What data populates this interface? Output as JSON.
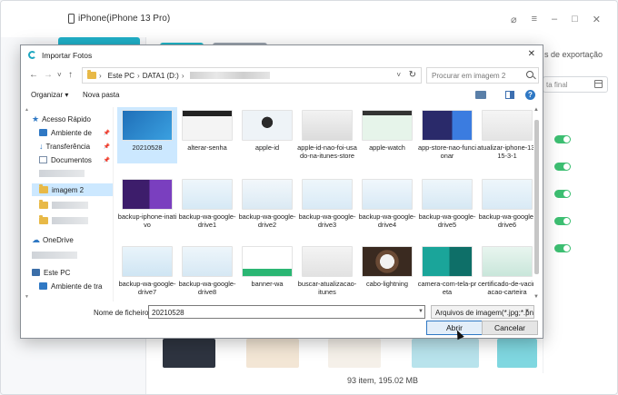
{
  "app": {
    "title": "iPhone(iPhone 13 Pro)",
    "export_label": "s de exportação",
    "date_placeholder": "ta final",
    "footer_status": "93 item, 195.02 MB",
    "accent_color": "#1fb6c9"
  },
  "dialog": {
    "title": "Importar Fotos",
    "close_label": "✕",
    "nav": {
      "back": "←",
      "forward": "→",
      "down": "˅",
      "up": "↑",
      "refresh": "↻"
    },
    "breadcrumb": [
      "Este PC",
      "DATA1 (D:)"
    ],
    "search_placeholder": "Procurar em imagem 2",
    "commands": {
      "organize": "Organizar ▾",
      "new_folder": "Nova pasta",
      "help": "?"
    },
    "nav_pane": [
      {
        "label": "Acesso Rápido",
        "icon": "star-icon"
      },
      {
        "label": "Ambiente de",
        "icon": "desktop-icon",
        "pinned": true
      },
      {
        "label": "Transferência",
        "icon": "download-icon",
        "pinned": true
      },
      {
        "label": "Documentos",
        "icon": "document-icon",
        "pinned": true
      },
      {
        "label": "",
        "icon": "blurred-item"
      },
      {
        "label": "imagem 2",
        "icon": "folder-icon",
        "selected": true
      },
      {
        "label": "",
        "icon": "folder-icon"
      },
      {
        "label": "",
        "icon": "folder-icon"
      },
      {
        "label": "OneDrive",
        "icon": "cloud-icon"
      },
      {
        "label": "",
        "icon": "blurred-item"
      },
      {
        "label": "Este PC",
        "icon": "computer-icon"
      },
      {
        "label": "Ambiente de tra",
        "icon": "desktop-icon"
      }
    ],
    "files": [
      {
        "label": "20210528",
        "selected": true
      },
      {
        "label": "alterar-senha"
      },
      {
        "label": "apple-id"
      },
      {
        "label": "apple-id-nao-foi-usado-na-itunes-store"
      },
      {
        "label": "apple-watch"
      },
      {
        "label": "app-store-nao-funcionar"
      },
      {
        "label": "atualizar-iphone-13-15-3-1"
      },
      {
        "label": "backup-iphone-inativo"
      },
      {
        "label": "backup-wa-google-drive1"
      },
      {
        "label": "backup-wa-google-drive2"
      },
      {
        "label": "backup-wa-google-drive3"
      },
      {
        "label": "backup-wa-google-drive4"
      },
      {
        "label": "backup-wa-google-drive5"
      },
      {
        "label": "backup-wa-google-drive6"
      },
      {
        "label": "backup-wa-google-drive7"
      },
      {
        "label": "backup-wa-google-drive8"
      },
      {
        "label": "banner-wa"
      },
      {
        "label": "buscar-atualizacao-itunes"
      },
      {
        "label": "cabo-lightning"
      },
      {
        "label": "camera-com-tela-preta"
      },
      {
        "label": "certificado-de-vacinacao-carteira"
      }
    ],
    "filename_label": "Nome de ficheiro:",
    "filename_value": "20210528",
    "filter_value": "Arquivos de imagem(*.jpg;*.pn",
    "open_button": "Abrir",
    "cancel_button": "Cancelar"
  }
}
